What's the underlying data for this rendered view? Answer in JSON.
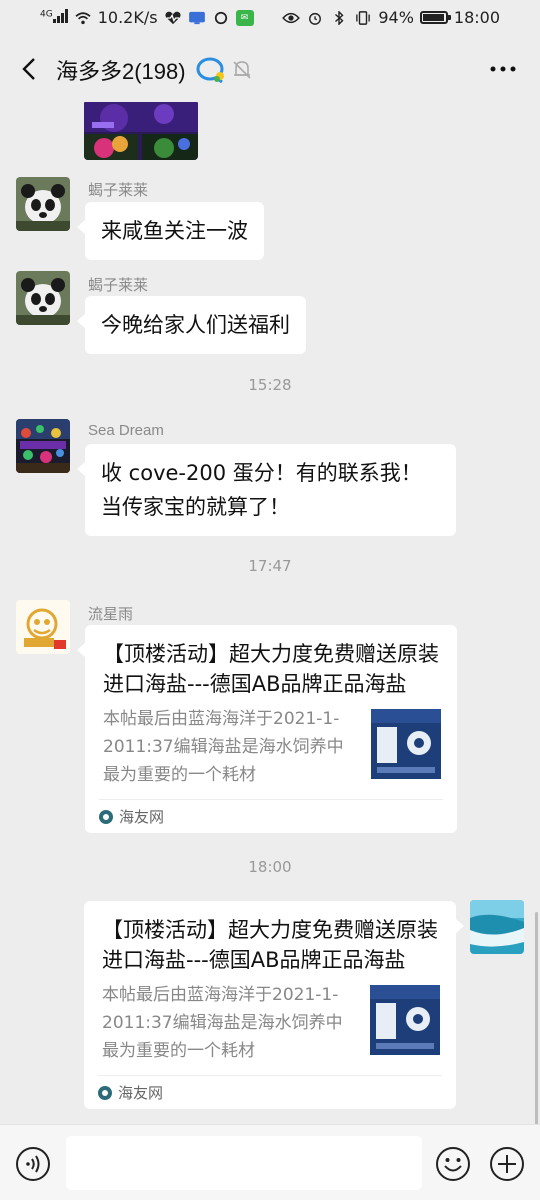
{
  "status_bar": {
    "network": "4G",
    "speed": "10.2K/s",
    "battery": "94%",
    "time": "18:00"
  },
  "header": {
    "title": "海多多2(198)",
    "back_icon": "chevron-left-icon",
    "more_icon": "more-dots-icon"
  },
  "messages": [
    {
      "sender": "蝎子莱莱",
      "text": "来咸鱼关注一波"
    },
    {
      "sender": "蝎子莱莱",
      "text": "今晚给家人们送福利"
    },
    {
      "time": "15:28"
    },
    {
      "sender": "Sea Dream",
      "line1": "收 cove-200 蛋分！有的联系我！",
      "line2": "当传家宝的就算了！"
    },
    {
      "time": "17:47"
    },
    {
      "sender": "流星雨",
      "card": {
        "title": "【顶楼活动】超大力度免费赠送原装进口海盐---德国AB品牌正品海盐",
        "desc": "本帖最后由蓝海海洋于2021-1-2011:37编辑海盐是海水饲养中最为重要的一个耗材",
        "source": "海友网"
      }
    },
    {
      "time": "18:00"
    },
    {
      "self": true,
      "card": {
        "title": "【顶楼活动】超大力度免费赠送原装进口海盐---德国AB品牌正品海盐",
        "desc": "本帖最后由蓝海海洋于2021-1-2011:37编辑海盐是海水饲养中最为重要的一个耗材",
        "source": "海友网"
      }
    }
  ],
  "input": {
    "placeholder": ""
  },
  "colors": {
    "background": "#ededed",
    "bubble": "#ffffff",
    "muted_text": "#999999"
  }
}
